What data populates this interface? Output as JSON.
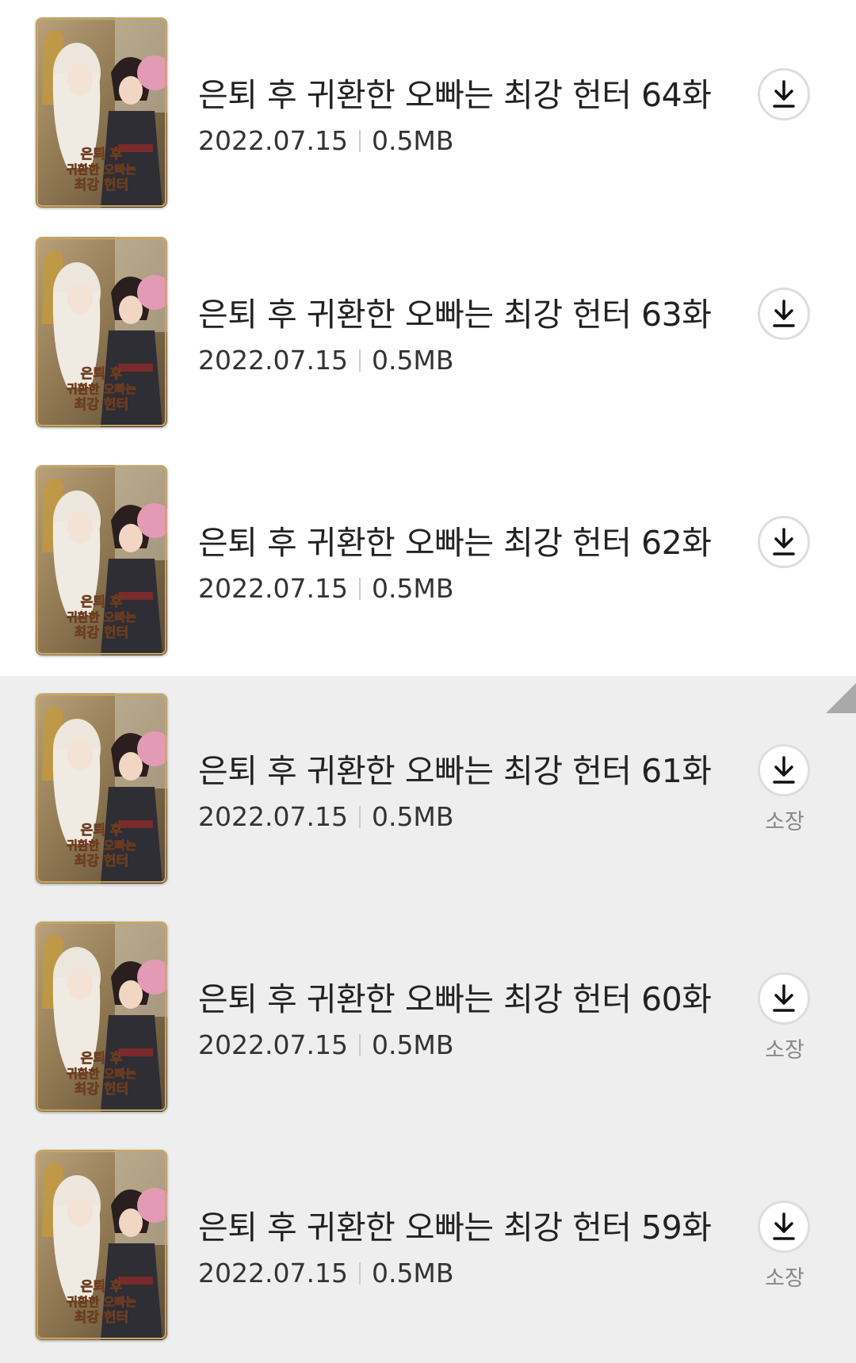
{
  "episodes": [
    {
      "title": "은퇴 후 귀환한 오빠는 최강 헌터 64화",
      "date": "2022.07.15",
      "size": "0.5MB",
      "owned": false,
      "cover_text": [
        "은퇴 후",
        "귀환한 오빠는",
        "최강 헌터"
      ],
      "action_icon": "download-icon"
    },
    {
      "title": "은퇴 후 귀환한 오빠는 최강 헌터 63화",
      "date": "2022.07.15",
      "size": "0.5MB",
      "owned": false,
      "cover_text": [
        "은퇴 후",
        "귀환한 오빠는",
        "최강 헌터"
      ],
      "action_icon": "download-icon"
    },
    {
      "title": "은퇴 후 귀환한 오빠는 최강 헌터 62화",
      "date": "2022.07.15",
      "size": "0.5MB",
      "owned": false,
      "cover_text": [
        "은퇴 후",
        "귀환한 오빠는",
        "최강 헌터"
      ],
      "action_icon": "download-icon"
    },
    {
      "title": "은퇴 후 귀환한 오빠는 최강 헌터 61화",
      "date": "2022.07.15",
      "size": "0.5MB",
      "owned": true,
      "owned_label": "소장",
      "cover_text": [
        "은퇴 후",
        "귀환한 오빠는",
        "최강 헌터"
      ],
      "action_icon": "download-icon"
    },
    {
      "title": "은퇴 후 귀환한 오빠는 최강 헌터 60화",
      "date": "2022.07.15",
      "size": "0.5MB",
      "owned": true,
      "owned_label": "소장",
      "cover_text": [
        "은퇴 후",
        "귀환한 오빠는",
        "최강 헌터"
      ],
      "action_icon": "download-icon"
    },
    {
      "title": "은퇴 후 귀환한 오빠는 최강 헌터 59화",
      "date": "2022.07.15",
      "size": "0.5MB",
      "owned": true,
      "owned_label": "소장",
      "cover_text": [
        "은퇴 후",
        "귀환한 오빠는",
        "최강 헌터"
      ],
      "action_icon": "download-icon"
    }
  ],
  "colors": {
    "owned_background": "#eeeeee",
    "title_text": "#222222",
    "meta_text": "#333333",
    "owned_label_text": "#888888",
    "fold_corner": "#a9a9a9"
  }
}
